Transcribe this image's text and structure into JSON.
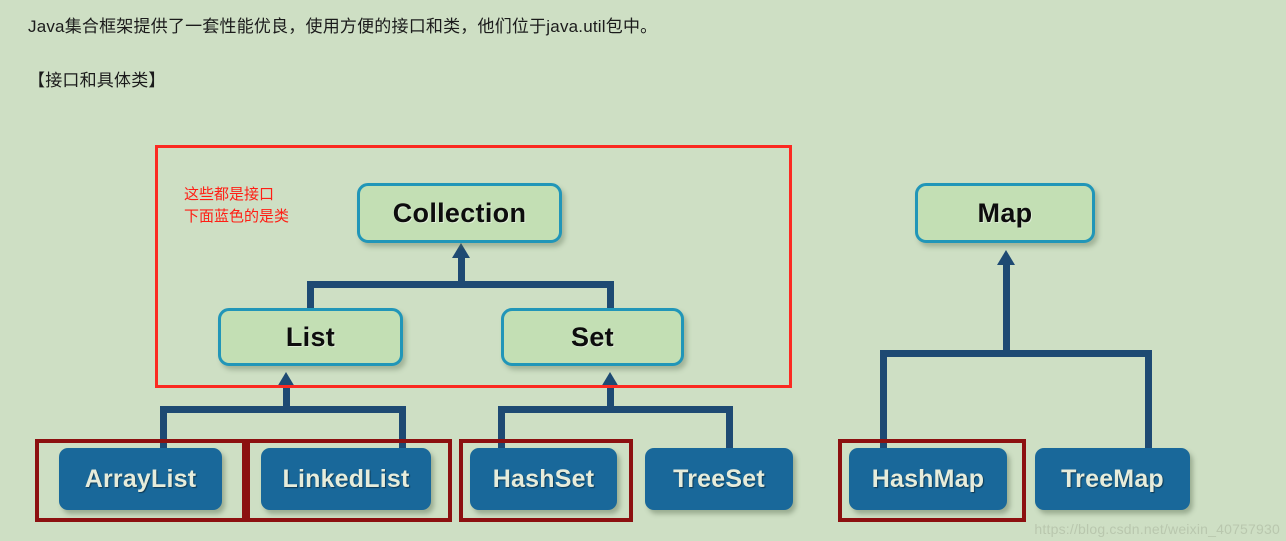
{
  "page": {
    "background_color": "#cedfc4",
    "intro_text": "Java集合框架提供了一套性能优良，使用方便的接口和类，他们位于java.util包中。",
    "section_text": "【接口和具体类】"
  },
  "annotation": {
    "line1": "这些都是接口",
    "line2": "下面蓝色的是类",
    "color": "#ff1e14",
    "frame_color": "#fb2a22"
  },
  "diagram": {
    "interface_color": "#c3dfb4",
    "interface_border_color": "#2196b8",
    "class_color": "#19689a",
    "class_text_color": "#e6ecdb",
    "connector_color": "#1e4a73",
    "highlight_color": "#8c1010",
    "interfaces": [
      {
        "id": "collection",
        "label": "Collection"
      },
      {
        "id": "list",
        "label": "List"
      },
      {
        "id": "set",
        "label": "Set"
      },
      {
        "id": "map",
        "label": "Map"
      }
    ],
    "classes": [
      {
        "id": "arraylist",
        "label": "ArrayList",
        "highlighted": true
      },
      {
        "id": "linkedlist",
        "label": "LinkedList",
        "highlighted": true
      },
      {
        "id": "hashset",
        "label": "HashSet",
        "highlighted": true
      },
      {
        "id": "treeset",
        "label": "TreeSet",
        "highlighted": false
      },
      {
        "id": "hashmap",
        "label": "HashMap",
        "highlighted": true
      },
      {
        "id": "treemap",
        "label": "TreeMap",
        "highlighted": false
      }
    ],
    "relations": [
      {
        "from": "list",
        "to": "collection"
      },
      {
        "from": "set",
        "to": "collection"
      },
      {
        "from": "arraylist",
        "to": "list"
      },
      {
        "from": "linkedlist",
        "to": "list"
      },
      {
        "from": "hashset",
        "to": "set"
      },
      {
        "from": "treeset",
        "to": "set"
      },
      {
        "from": "hashmap",
        "to": "map"
      },
      {
        "from": "treemap",
        "to": "map"
      }
    ]
  },
  "watermark": {
    "text": "https://blog.csdn.net/weixin_40757930"
  }
}
